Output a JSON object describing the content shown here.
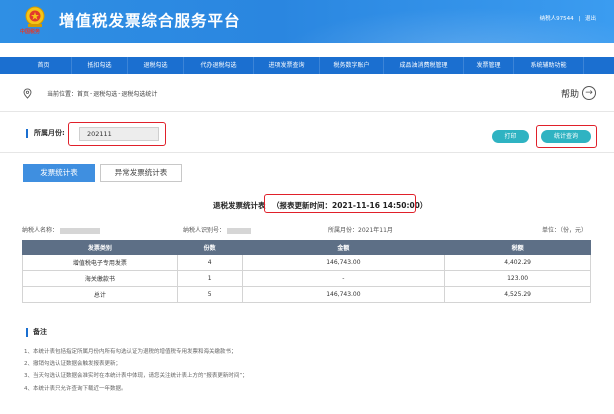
{
  "header": {
    "logo_text": "中国税务",
    "title": "增值税发票综合服务平台",
    "user_label": "纳税人97544",
    "user_separator": "|",
    "logout_label": "退出"
  },
  "nav": {
    "items": [
      "首页",
      "抵扣勾选",
      "退税勾选",
      "代办退税勾选",
      "进项发票查询",
      "税务数字账户",
      "成品油消费税管理",
      "发票管理",
      "系统辅助功能"
    ]
  },
  "breadcrumb": {
    "prefix": "当前位置：",
    "items": [
      "首页",
      "退税勾选",
      "退税勾选统计"
    ],
    "separator": "-"
  },
  "help": {
    "label": "帮助",
    "icon": "arrow-right-circle-icon"
  },
  "filter": {
    "month_label": "所属月份:",
    "month_value": "202111"
  },
  "actions": {
    "print_label": "打印",
    "query_label": "统计查询"
  },
  "tabs": [
    {
      "label": "发票统计表",
      "active": true
    },
    {
      "label": "异常发票统计表",
      "active": false
    }
  ],
  "report": {
    "title": "退税发票统计表",
    "update_time": "（报表更新时间：2021-11-16 14:50:00）",
    "taxpayer_name_label": "纳税人名称：",
    "taxpayer_id_label": "纳税人识别号：",
    "period": "所属月份：2021年11月",
    "unit": "单位：（份，元）"
  },
  "table": {
    "headers": [
      "发票类别",
      "份数",
      "金额",
      "税额"
    ],
    "rows": [
      [
        "增值税电子专用发票",
        "4",
        "146,743.00",
        "4,402.29"
      ],
      [
        "海关缴款书",
        "1",
        "-",
        "123.00"
      ],
      [
        "总计",
        "5",
        "146,743.00",
        "4,525.29"
      ]
    ]
  },
  "notes": {
    "title": "备注",
    "items": [
      "1、本统计表包括指定所属月份内所有勾选认证为退税的增值税专用发票和海关缴款书；",
      "2、撤销勾选认证数据会触发报表更新；",
      "3、当天勾选认证数据会准实时在本统计表中体现，请您关注统计表上方的“报表更新时间”；",
      "4、本统计表只允许查询下载近一年数据。"
    ]
  },
  "colors": {
    "header_bg": "#2a86e0",
    "nav_bg": "#1b6fd0",
    "action_btn": "#2fb3c2",
    "table_header": "#5d6f86",
    "highlight_box": "#e0202a"
  }
}
